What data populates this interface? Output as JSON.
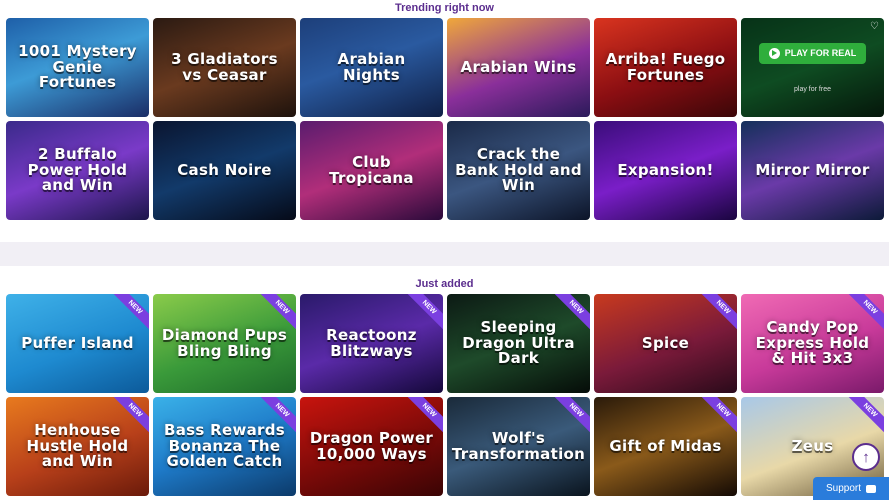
{
  "trending": {
    "title": "Trending right now",
    "tiles": [
      {
        "name": "1001 Mystery Genie Fortunes",
        "bg": "linear-gradient(160deg,#1e5fa8,#3d9bd6 45%,#1a2d66)"
      },
      {
        "name": "3 Gladiators vs Ceasar",
        "bg": "linear-gradient(160deg,#2b1a12,#6a3a1f 50%,#1e120c)"
      },
      {
        "name": "Arabian Nights",
        "bg": "linear-gradient(160deg,#1d3f7a,#2a5aa0 45%,#0f1f45)"
      },
      {
        "name": "Arabian Wins",
        "bg": "linear-gradient(160deg,#f0a83a,#8a2f9a 55%,#2b1a5a)"
      },
      {
        "name": "Arriba! Fuego Fortunes",
        "bg": "linear-gradient(160deg,#d9341f,#8a0e12 55%,#3b0608)"
      },
      {
        "name": "",
        "bg": "linear-gradient(160deg,#0d5c2c,#1b8a3e 50%,#0a2a14)",
        "play_label": "PLAY FOR REAL",
        "play_free": "play for free"
      },
      {
        "name": "2 Buffalo Power Hold and Win",
        "bg": "linear-gradient(160deg,#3a2a8a,#7a3ac8 50%,#1c154a)"
      },
      {
        "name": "Cash Noire",
        "bg": "linear-gradient(160deg,#0a1530,#123a6a 50%,#050a18)"
      },
      {
        "name": "Club Tropicana",
        "bg": "linear-gradient(160deg,#5a1c6e,#b12e7a 50%,#2a0a3a)"
      },
      {
        "name": "Crack the Bank Hold and Win",
        "bg": "linear-gradient(160deg,#1b2a48,#3b5680 50%,#0c1428)"
      },
      {
        "name": "Expansion!",
        "bg": "linear-gradient(160deg,#3a0d7a,#7a1ec8 50%,#1a0540)"
      },
      {
        "name": "Mirror Mirror",
        "bg": "linear-gradient(160deg,#14305a,#6a3aa8 50%,#0c1a38)"
      }
    ]
  },
  "just_added": {
    "title": "Just added",
    "badge": "NEW",
    "tiles": [
      {
        "name": "Puffer Island",
        "bg": "linear-gradient(160deg,#3fb1e8,#1e8ad0 55%,#0c5a9a)"
      },
      {
        "name": "Diamond Pups Bling Bling",
        "bg": "linear-gradient(160deg,#8acb4a,#3a9a3a 55%,#1e6a2a)"
      },
      {
        "name": "Reactoonz Blitzways",
        "bg": "linear-gradient(160deg,#2a1a6a,#5a2aa8 50%,#14083a)"
      },
      {
        "name": "Sleeping Dragon Ultra Dark",
        "bg": "linear-gradient(160deg,#0c1a14,#1e4a2a 50%,#050c08)"
      },
      {
        "name": "Spice",
        "bg": "linear-gradient(160deg,#c83a1e,#7a1a3a 55%,#2a0a1a)"
      },
      {
        "name": "Candy Pop Express Hold & Hit 3x3",
        "bg": "linear-gradient(160deg,#f06ab4,#c83a9a 55%,#7a1a6a)"
      },
      {
        "name": "Henhouse Hustle Hold and Win",
        "bg": "linear-gradient(160deg,#e87a1e,#b8401a 55%,#6a1a0a)"
      },
      {
        "name": "Bass Rewards Bonanza The Golden Catch",
        "bg": "linear-gradient(160deg,#3ab1e8,#1e7ac8 50%,#0c3a6a)"
      },
      {
        "name": "Dragon Power 10,000 Ways",
        "bg": "linear-gradient(160deg,#c8140e,#7a0a08 55%,#3a0404)"
      },
      {
        "name": "Wolf's Transformation",
        "bg": "linear-gradient(160deg,#1a2a3a,#3a5a7a 50%,#0a141e)"
      },
      {
        "name": "Gift of Midas",
        "bg": "linear-gradient(160deg,#2a1a0a,#8a5a1a 50%,#140a04)"
      },
      {
        "name": "Zeus",
        "bg": "linear-gradient(160deg,#a8c8e8,#e8d8a8 55%,#6a5a3a)"
      }
    ]
  },
  "support": {
    "label": "Support"
  },
  "scroll_top": {
    "icon": "arrow-up-icon"
  }
}
